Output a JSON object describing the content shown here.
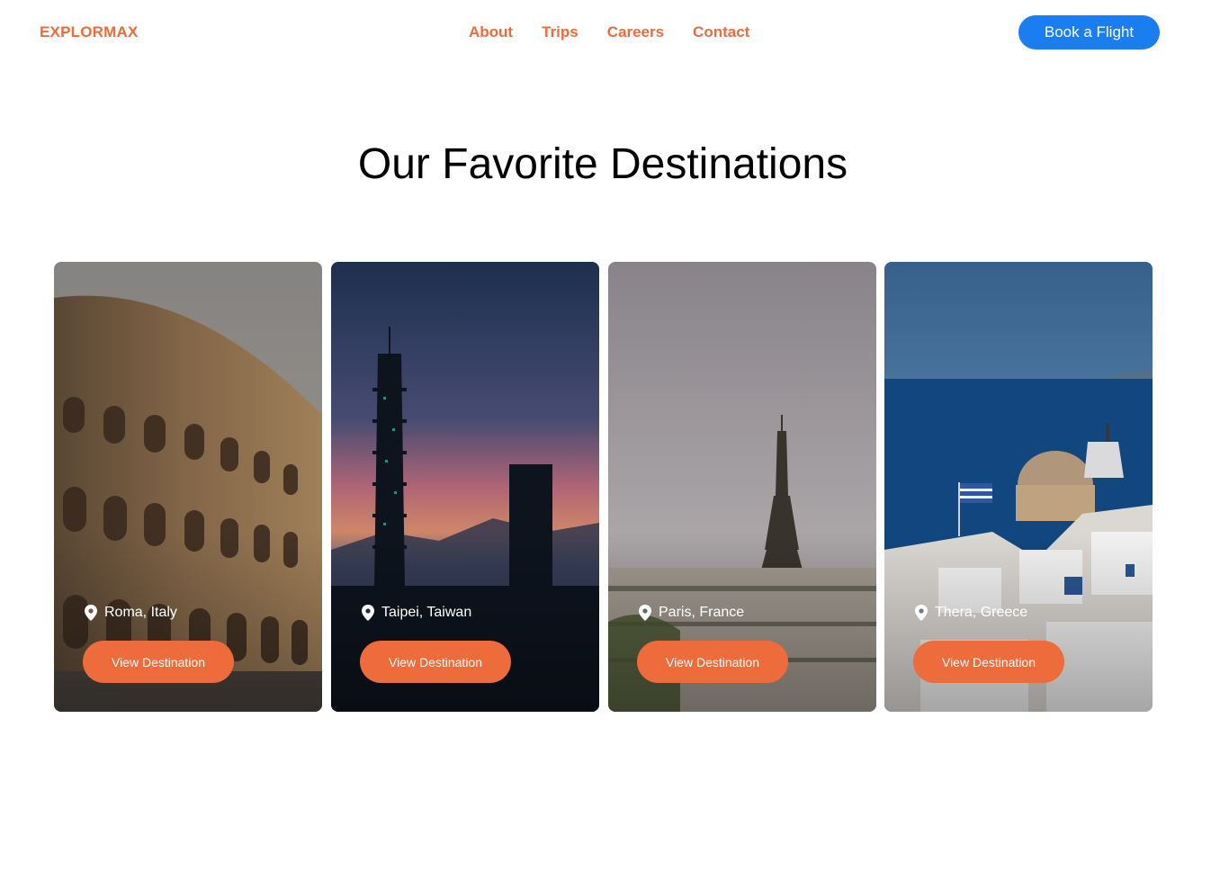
{
  "brand": {
    "logo_text": "EXPLORMAX",
    "accent_color": "#ee6b3b",
    "primary_button_color": "#1a7ef0"
  },
  "nav": {
    "links": [
      "About",
      "Trips",
      "Careers",
      "Contact"
    ],
    "cta_label": "Book a Flight"
  },
  "section": {
    "title": "Our Favorite Destinations"
  },
  "destinations": [
    {
      "location": "Roma, Italy",
      "button_label": "View Destination",
      "image_subject": "colosseum"
    },
    {
      "location": "Taipei, Taiwan",
      "button_label": "View Destination",
      "image_subject": "taipei-101-tower"
    },
    {
      "location": "Paris, France",
      "button_label": "View Destination",
      "image_subject": "eiffel-tower"
    },
    {
      "location": "Thera, Greece",
      "button_label": "View Destination",
      "image_subject": "santorini-domes"
    }
  ],
  "icons": {
    "location": "map-pin-icon"
  }
}
